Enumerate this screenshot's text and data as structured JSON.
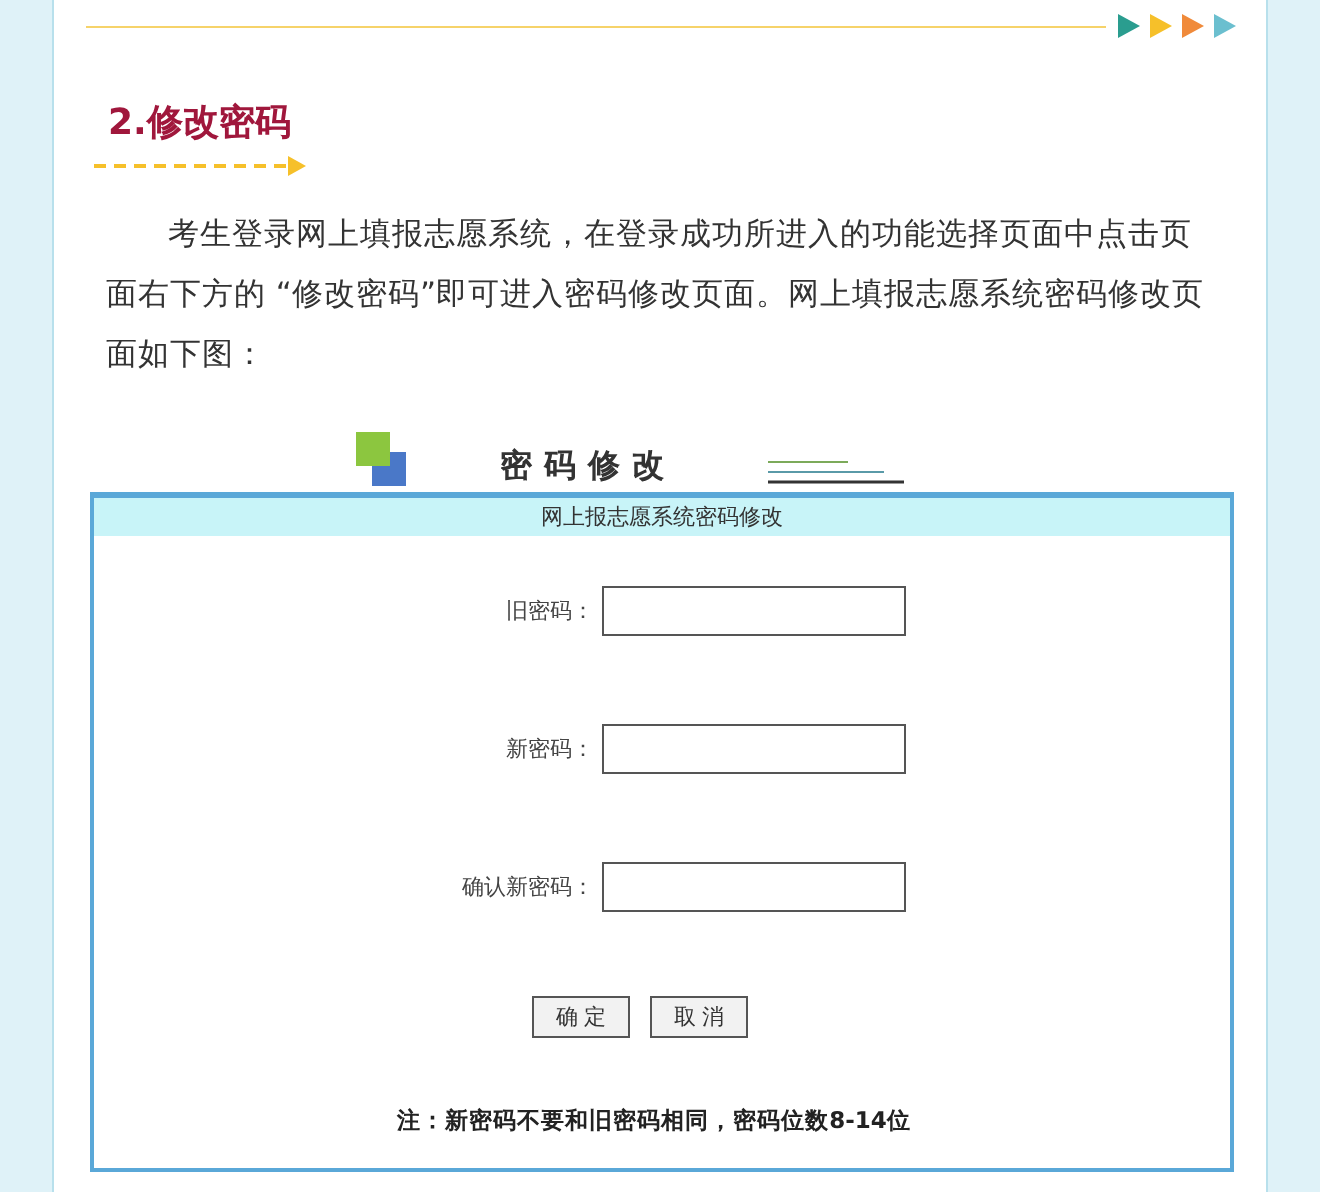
{
  "section": {
    "heading": "2.修改密码",
    "paragraph": "考生登录网上填报志愿系统，在登录成功所进入的功能选择页面中点击页面右下方的 “修改密码”即可进入密码修改页面。网上填报志愿系统密码修改页面如下图："
  },
  "screenshot": {
    "title": "密码修改",
    "panel_title": "网上报志愿系统密码修改",
    "fields": [
      {
        "label": "旧密码："
      },
      {
        "label": "新密码："
      },
      {
        "label": "确认新密码："
      }
    ],
    "buttons": [
      "确 定",
      "取 消"
    ],
    "note": "注：新密码不要和旧密码相同，密码位数8-14位"
  }
}
